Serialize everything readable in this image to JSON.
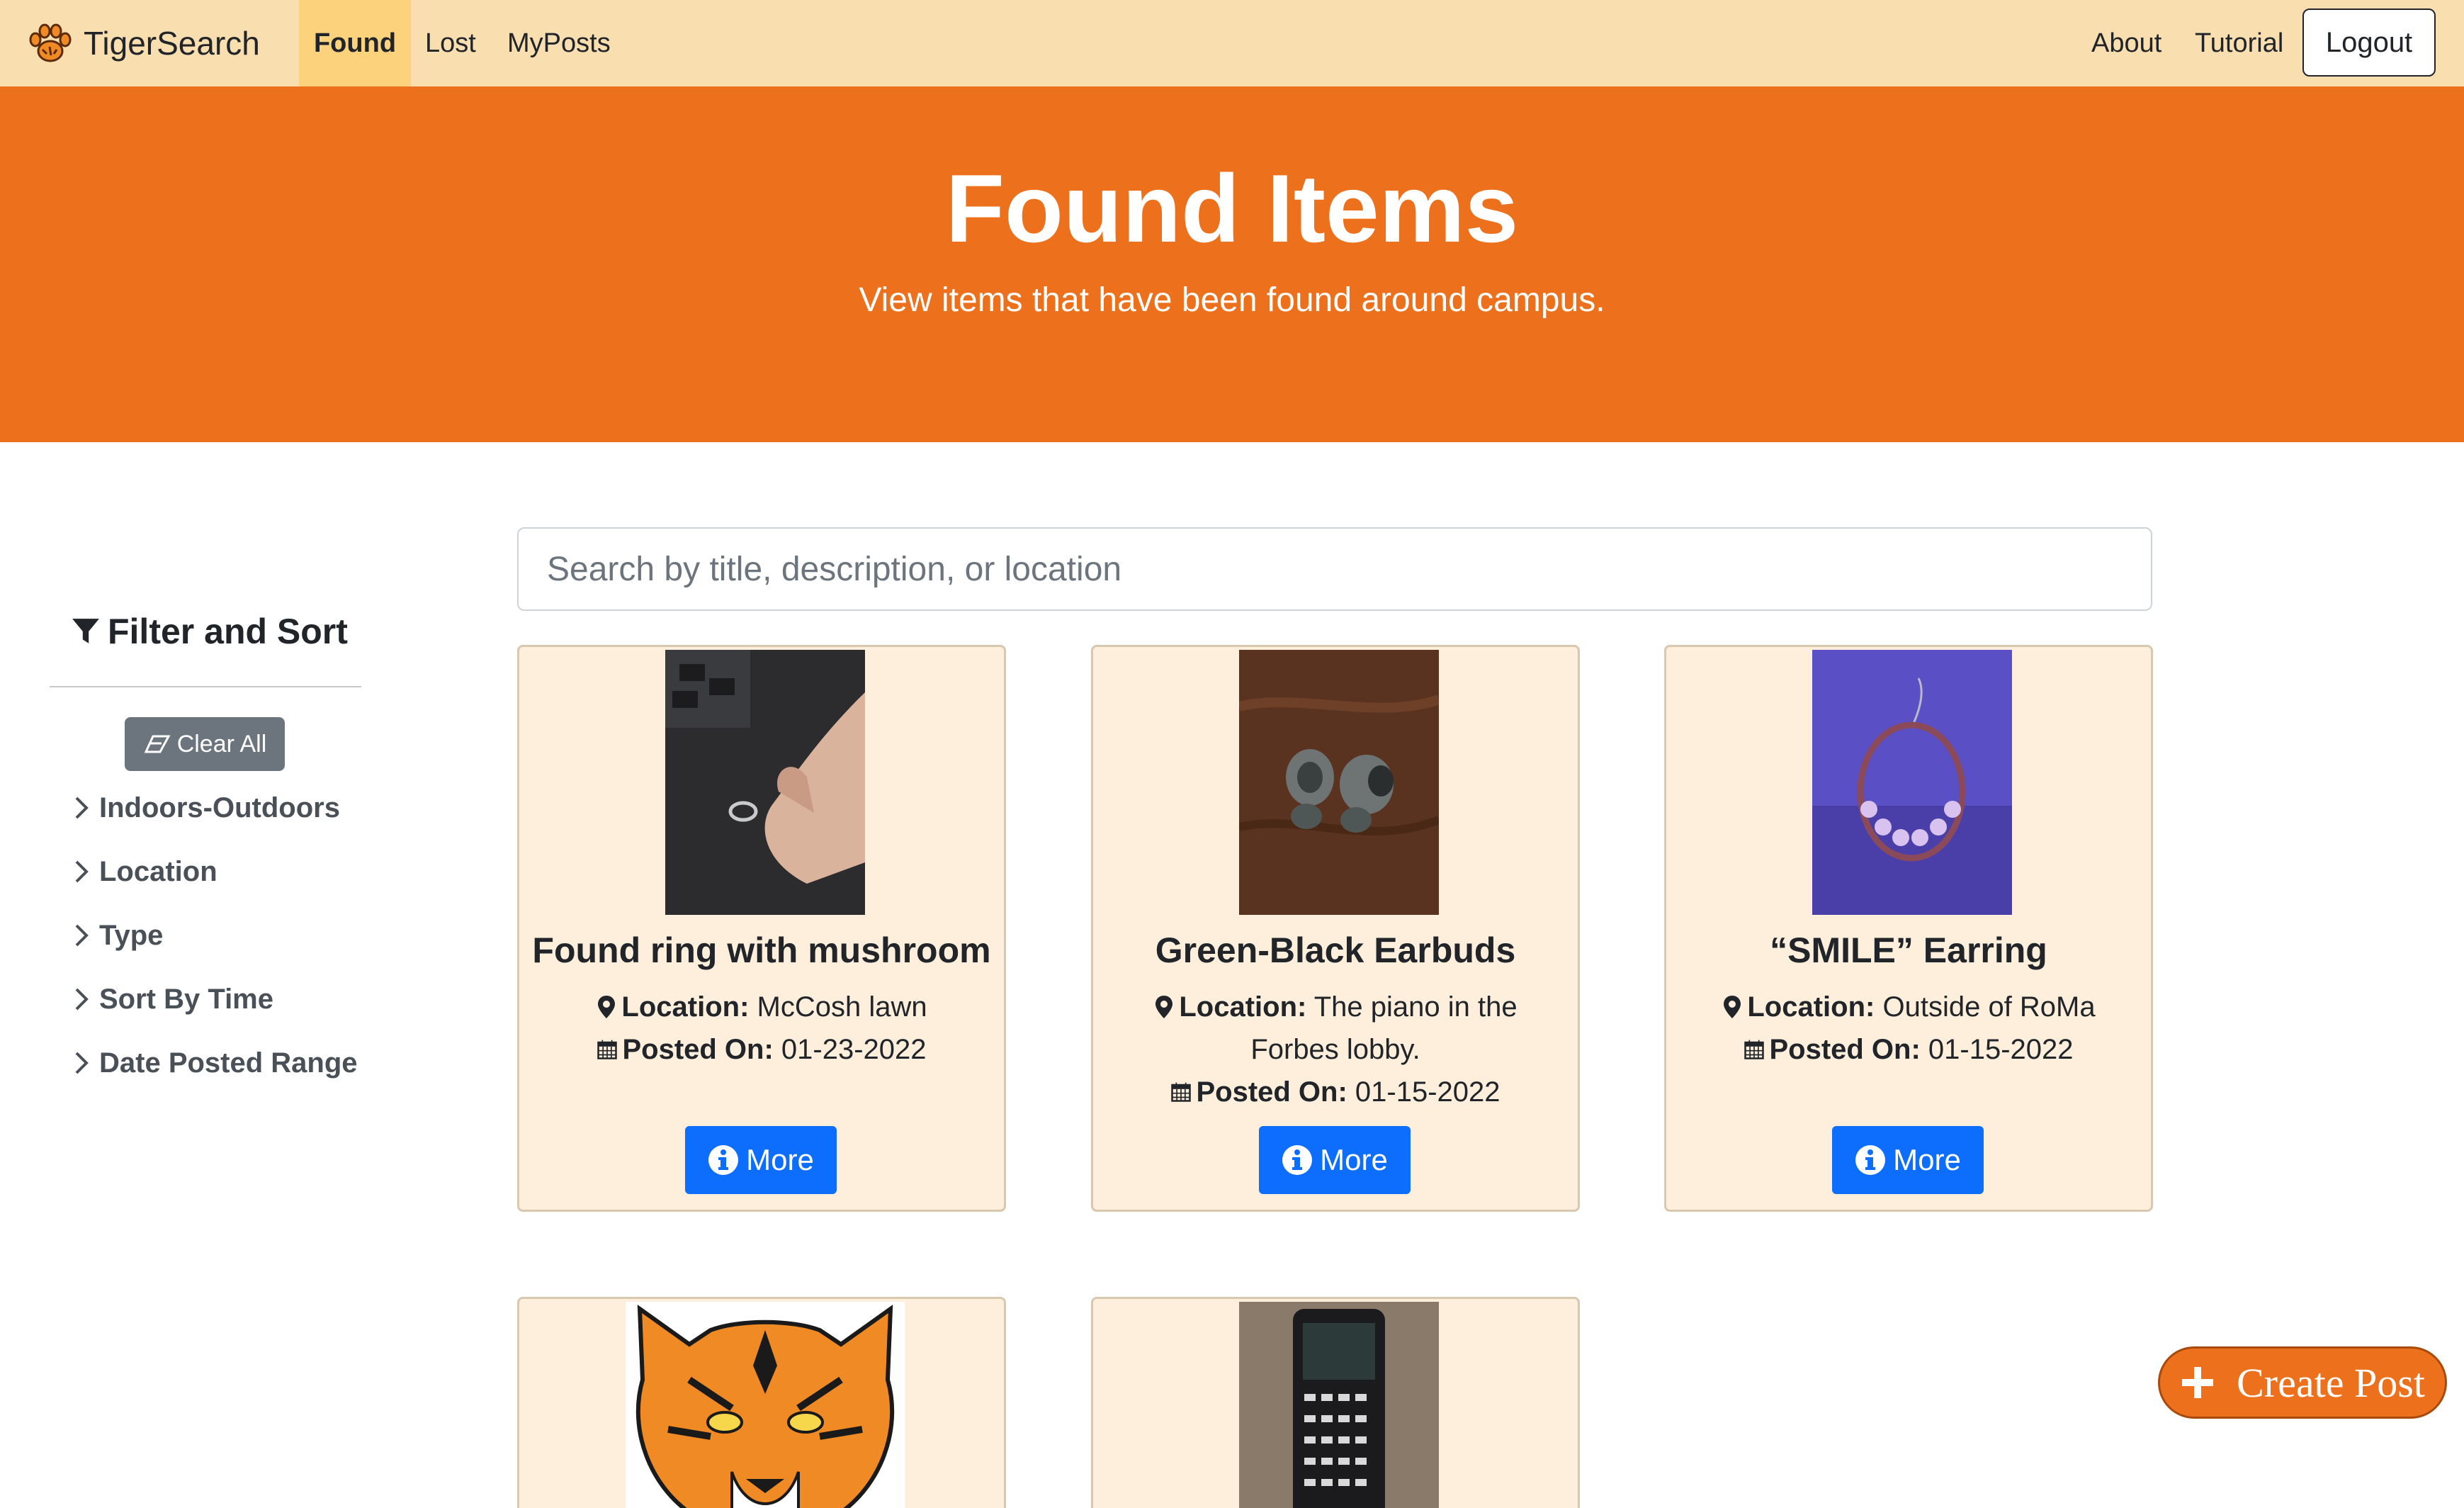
{
  "navbar": {
    "brand": "TigerSearch",
    "links": [
      "Found",
      "Lost",
      "MyPosts"
    ],
    "active": "Found",
    "right_links": [
      "About",
      "Tutorial"
    ],
    "logout": "Logout"
  },
  "hero": {
    "title": "Found Items",
    "subtitle": "View items that have been found around campus."
  },
  "sidebar": {
    "title": "Filter and Sort",
    "clear_label": "Clear All",
    "filters": [
      "Indoors-Outdoors",
      "Location",
      "Type",
      "Sort By Time",
      "Date Posted Range"
    ]
  },
  "search": {
    "placeholder": "Search by title, description, or location",
    "value": ""
  },
  "labels": {
    "location": "Location:",
    "posted_on": "Posted On:",
    "more": "More"
  },
  "cards": [
    {
      "title": "Found ring with mushroom",
      "location": "McCosh lawn",
      "posted_on": "01-23-2022"
    },
    {
      "title": "Green-Black Earbuds",
      "location": "The piano in the Forbes lobby.",
      "posted_on": "01-15-2022"
    },
    {
      "title": "“SMILE” Earring",
      "location": "Outside of RoMa",
      "posted_on": "01-15-2022"
    }
  ],
  "create_post": "Create Post",
  "colors": {
    "navbar_bg": "#f9deb0",
    "nav_active_bg": "#fcd27c",
    "hero_bg": "#ed711c",
    "card_bg": "#fdefdc",
    "more_button": "#0d6efd",
    "clear_button": "#6c757d",
    "create_button": "#ed711c"
  }
}
